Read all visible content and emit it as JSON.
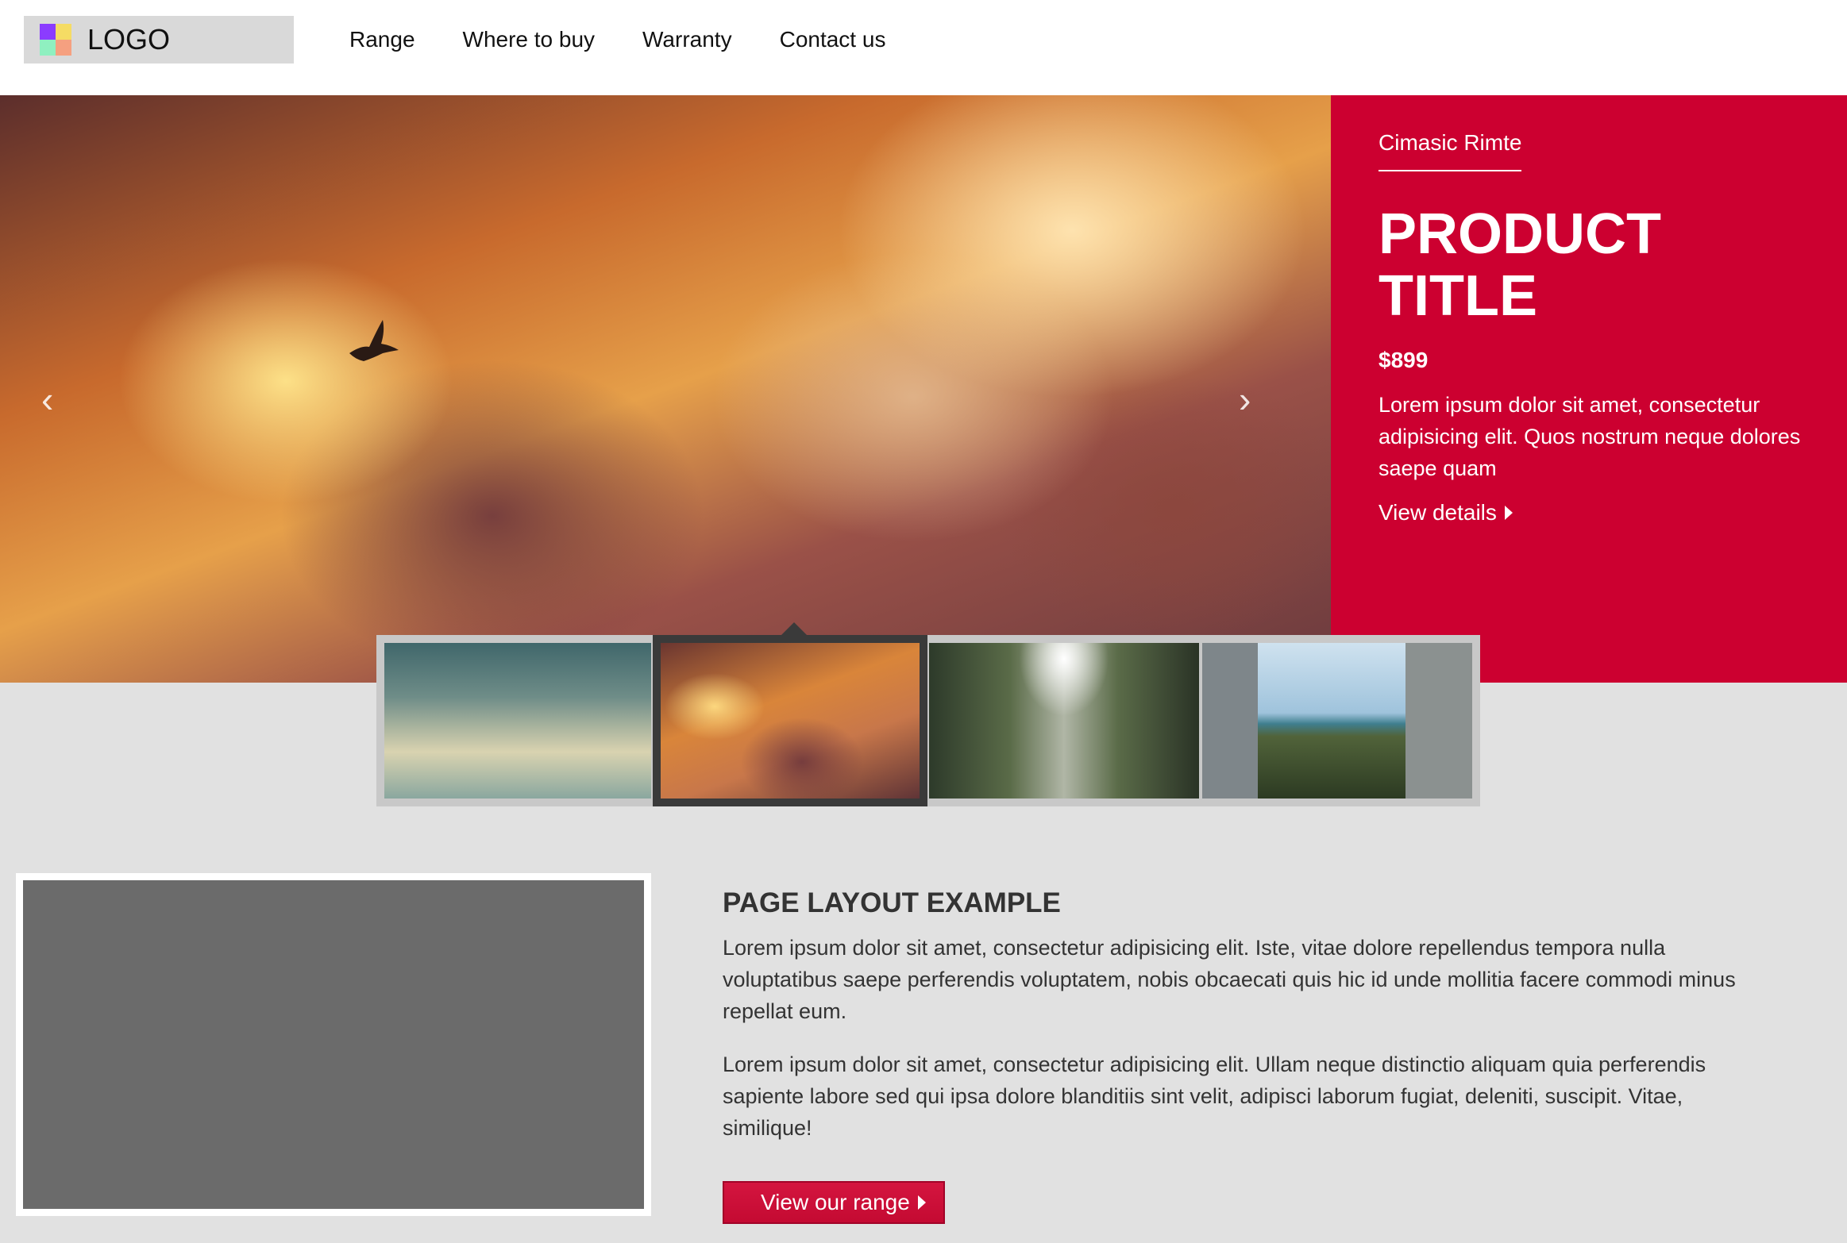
{
  "header": {
    "logo_text": "LOGO",
    "logo_colors": [
      "#8b3cff",
      "#f5dc64",
      "#8ff0c0",
      "#f5a080"
    ],
    "nav": [
      "Range",
      "Where to buy",
      "Warranty",
      "Contact us"
    ]
  },
  "hero": {
    "prev_icon": "‹",
    "next_icon": "›",
    "brand": "Cimasic Rimte",
    "title_line1": "PRODUCT",
    "title_line2": "TITLE",
    "price": "$899",
    "description": "Lorem ipsum dolor sit amet, consectetur adipisicing elit. Quos nostrum neque dolores saepe quam",
    "cta": "View details",
    "accent_color": "#cc0030"
  },
  "thumbnails": [
    {
      "name": "sky-clouds"
    },
    {
      "name": "sunset-bird",
      "selected": true
    },
    {
      "name": "green-buildings"
    },
    {
      "name": "city-sea-view"
    }
  ],
  "section": {
    "title": "PAGE LAYOUT EXAMPLE",
    "paragraph1": "Lorem ipsum dolor sit amet, consectetur adipisicing elit. Iste, vitae dolore repellendus tempora nulla voluptatibus saepe perferendis voluptatem, nobis obcaecati quis hic id unde mollitia facere commodi minus repellat eum.",
    "paragraph2": "Lorem ipsum dolor sit amet, consectetur adipisicing elit. Ullam neque distinctio aliquam quia perferendis sapiente labore sed qui ipsa dolore blanditiis sint velit, adipisci laborum fugiat, deleniti, suscipit. Vitae, similique!",
    "button": "View our range"
  }
}
